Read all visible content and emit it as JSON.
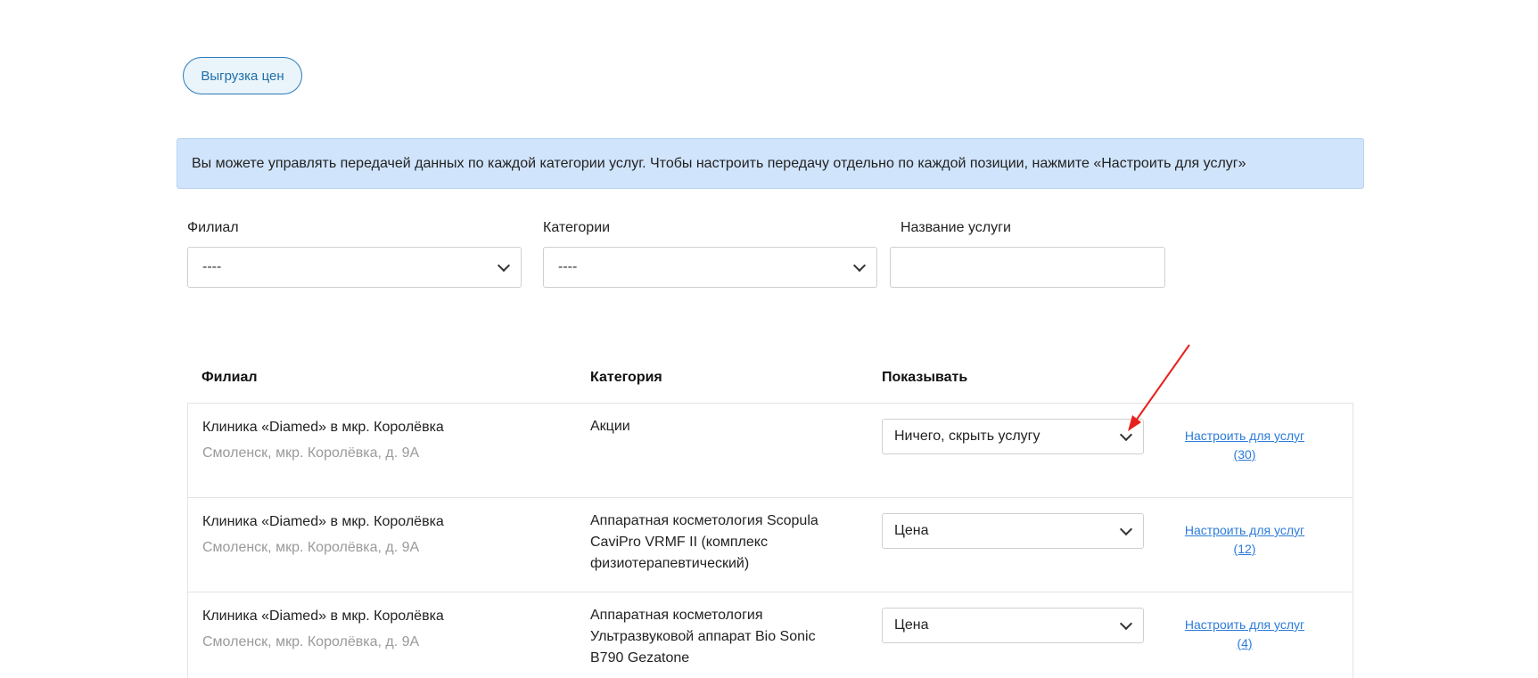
{
  "header": {
    "export_button": "Выгрузка цен"
  },
  "info": "Вы можете управлять передачей данных по каждой категории услуг. Чтобы настроить передачу отдельно по каждой позиции, нажмите «Настроить для услуг»",
  "filters": {
    "branch": {
      "label": "Филиал",
      "value": "----"
    },
    "category": {
      "label": "Категории",
      "value": "----"
    },
    "service": {
      "label": "Название услуги",
      "value": "",
      "placeholder": ""
    }
  },
  "table": {
    "headers": {
      "branch": "Филиал",
      "category": "Категория",
      "show": "Показывать"
    },
    "rows": [
      {
        "branch": "Клиника «Diamed» в мкр. Королёвка",
        "address": "Смоленск, мкр. Королёвка, д. 9А",
        "category": "Акции",
        "show": "Ничего, скрыть услугу",
        "link": "Настроить для услуг",
        "count": "(30)"
      },
      {
        "branch": "Клиника «Diamed» в мкр. Королёвка",
        "address": "Смоленск, мкр. Королёвка, д. 9А",
        "category": "Аппаратная косметология Scopula CaviPro VRMF II (комплекс физиотерапевтический)",
        "show": "Цена",
        "link": "Настроить для услуг",
        "count": "(12)"
      },
      {
        "branch": "Клиника «Diamed» в мкр. Королёвка",
        "address": "Смоленск, мкр. Королёвка, д. 9А",
        "category": "Аппаратная косметология Ультразвуковой аппарат Bio Sonic B790 Gezatone",
        "show": "Цена",
        "link": "Настроить для услуг",
        "count": "(4)"
      }
    ]
  },
  "colors": {
    "accent": "#2b7bd9",
    "banner": "#d0e4fb",
    "annotation_arrow": "#e8201c"
  },
  "icons": {
    "select_arrow": "chevron-down-icon",
    "annotation": "red-arrow-annotation-icon"
  }
}
